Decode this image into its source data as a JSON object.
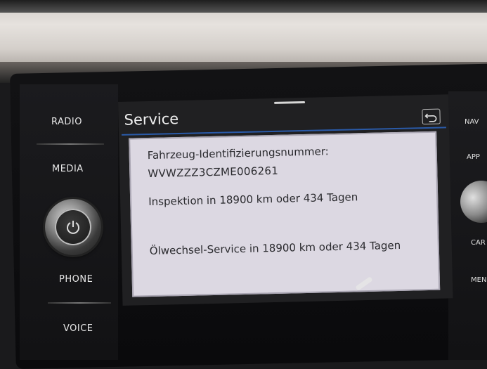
{
  "left_menu": {
    "radio": "RADIO",
    "media": "MEDIA",
    "phone": "PHONE",
    "voice": "VOICE"
  },
  "right_menu": {
    "nav": "NAV",
    "app": "APP",
    "car": "CAR",
    "menu": "MEN"
  },
  "screen": {
    "title": "Service",
    "back_icon": "back-arrow-icon",
    "accent_color": "#2a5aa8"
  },
  "service_info": {
    "vin_label": "Fahrzeug-Identifizierungsnummer:",
    "vin_value": "WVWZZZ3CZME006261",
    "inspection": "Inspektion in 18900 km oder 434 Tagen",
    "oil_service": "Ölwechsel-Service in 18900 km oder 434 Tagen"
  },
  "icons": {
    "power_knob": "power-icon"
  }
}
